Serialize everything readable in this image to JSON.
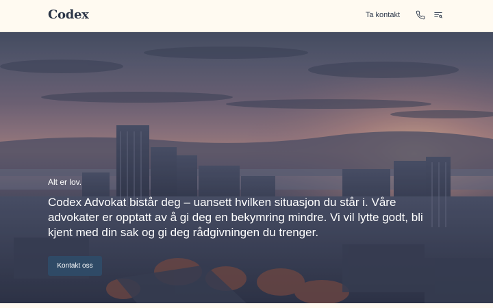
{
  "header": {
    "logo": "Codex",
    "contact_link": "Ta kontakt",
    "phone_icon": "phone-icon",
    "menu_icon": "menu-filter-icon"
  },
  "hero": {
    "eyebrow": "Alt er lov.",
    "lead": "Codex Advokat bistår deg – uansett hvilken situasjon du står i. Våre advokater er opptatt av å gi deg en bekymring mindre. Vi vil lytte godt, bli kjent med din sak og gi deg rådgivningen du trenger.",
    "cta_label": "Kontakt oss"
  },
  "colors": {
    "background": "#fffaf1",
    "text_dark": "#2a3446",
    "button": "#2f4a66"
  }
}
